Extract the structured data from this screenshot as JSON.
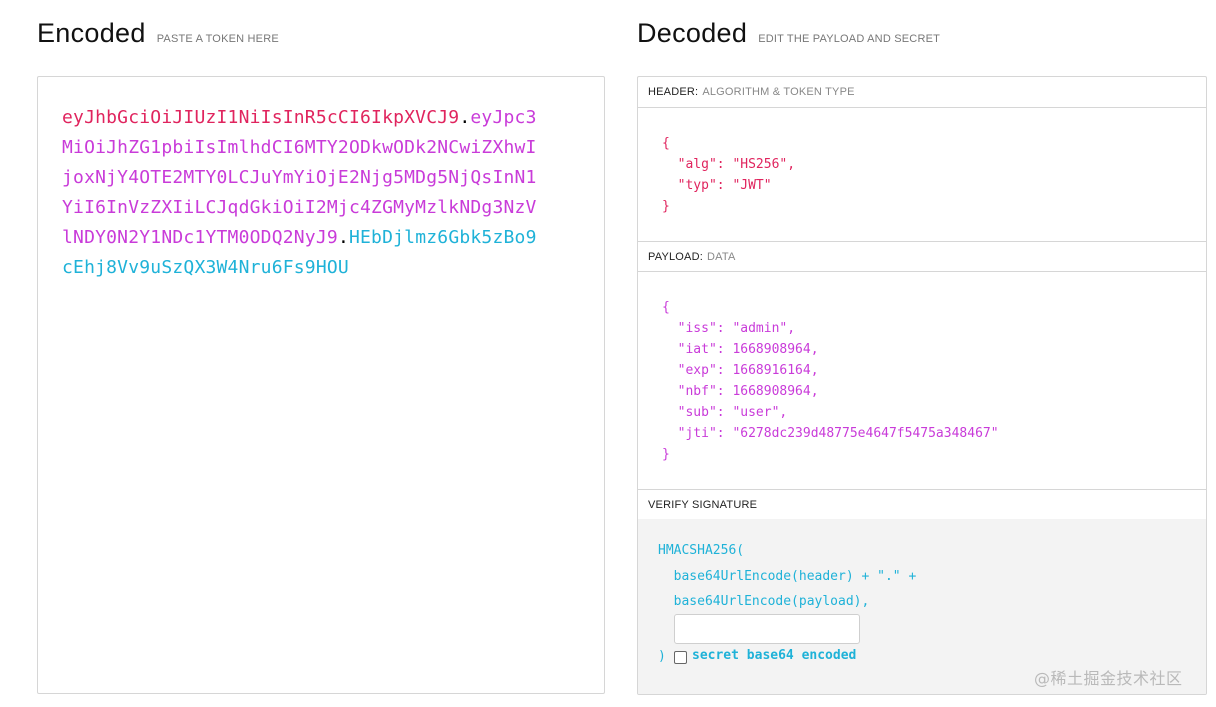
{
  "encoded": {
    "title": "Encoded",
    "subtitle": "PASTE A TOKEN HERE",
    "token_header": "eyJhbGciOiJIUzI1NiIsInR5cCI6IkpXVCJ9",
    "dot1": ".",
    "token_payload": "eyJpc3MiOiJhZG1pbiIsImlhdCI6MTY2ODkwODk2NCwiZXhwIjoxNjY4OTE2MTY0LCJuYmYiOjE2Njg5MDg5NjQsInN1YiI6InVzZXIiLCJqdGkiOiI2Mjc4ZGMyMzlkNDg3NzVlNDY0N2Y1NDc1YTM0ODQ2NyJ9",
    "dot2": ".",
    "token_signature": "HEbDjlmz6Gbk5zBo9cEhj8Vv9uSzQX3W4Nru6Fs9HOU"
  },
  "decoded": {
    "title": "Decoded",
    "subtitle": "EDIT THE PAYLOAD AND SECRET",
    "header_section": {
      "label": "HEADER:",
      "sublabel": "ALGORITHM & TOKEN TYPE",
      "json": "{\n  \"alg\": \"HS256\",\n  \"typ\": \"JWT\"\n}"
    },
    "payload_section": {
      "label": "PAYLOAD:",
      "sublabel": "DATA",
      "json": "{\n  \"iss\": \"admin\",\n  \"iat\": 1668908964,\n  \"exp\": 1668916164,\n  \"nbf\": 1668908964,\n  \"sub\": \"user\",\n  \"jti\": \"6278dc239d48775e4647f5475a348467\"\n}"
    },
    "verify_section": {
      "label": "VERIFY SIGNATURE",
      "line1": "HMACSHA256(",
      "line2": "  base64UrlEncode(header) + \".\" +",
      "line3": "  base64UrlEncode(payload),",
      "secret_value": "",
      "close_paren": ")",
      "checkbox_label": "secret base64 encoded",
      "checkbox_checked": false
    }
  },
  "watermark": "@稀土掘金技术社区",
  "colors": {
    "header": "#e0245e",
    "payload": "#c93bd9",
    "signature": "#1fb2d8"
  }
}
